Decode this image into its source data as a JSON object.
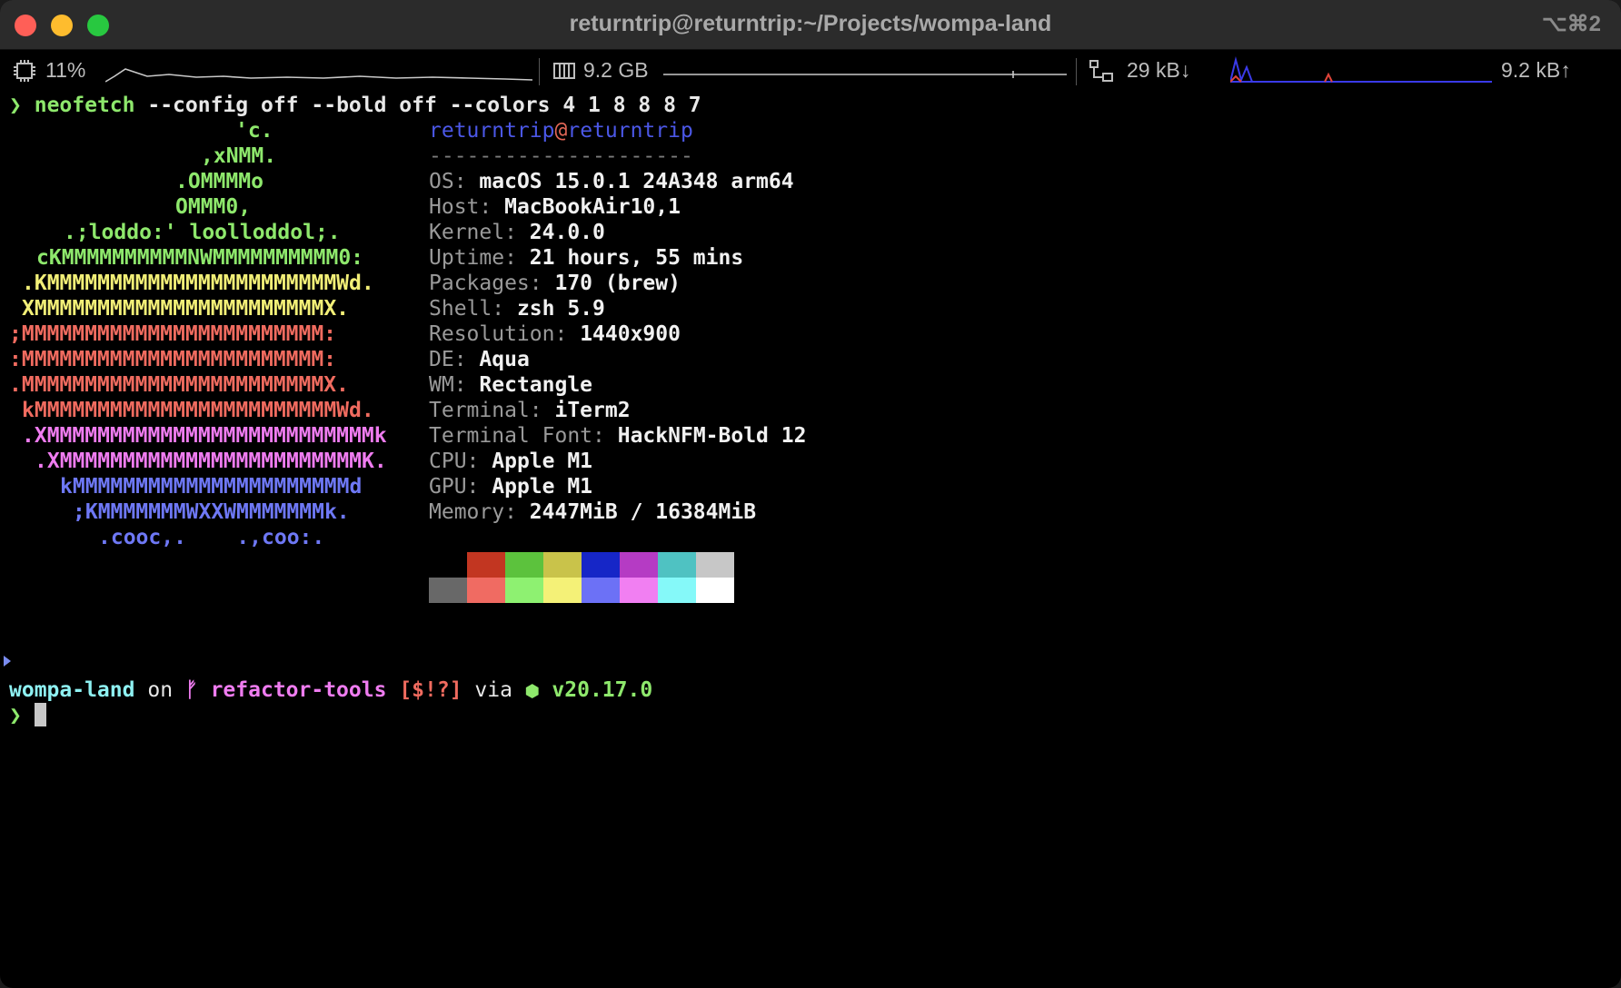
{
  "window": {
    "title": "returntrip@returntrip:~/Projects/wompa-land",
    "shortcut": "⌥⌘2"
  },
  "status": {
    "cpu": "11%",
    "memory": "9.2 GB",
    "net_down": "29 kB↓",
    "net_up": "9.2 kB↑",
    "icons": [
      "cpu-chip-icon",
      "memory-icon",
      "network-icon"
    ]
  },
  "command": {
    "prompt": "❯",
    "name": "neofetch",
    "args": "--config off --bold off --colors 4 1 8 8 8 7"
  },
  "logo": {
    "lines": [
      {
        "text": "'c.",
        "color": "#8ee86c"
      },
      {
        "text": ",xNMM.",
        "color": "#8ee86c"
      },
      {
        "text": ".OMMMMo",
        "color": "#8ee86c"
      },
      {
        "text": "OMMM0,",
        "color": "#8ee86c"
      },
      {
        "text": ".;loddo:' loolloddol;.",
        "color": "#8ee86c"
      },
      {
        "text": "cKMMMMMMMMMMNWMMMMMMMMMM0:",
        "color": "#8ee86c"
      },
      {
        "text": ".KMMMMMMMMMMMMMMMMMMMMMMMWd.",
        "color": "#f2ef77"
      },
      {
        "text": "XMMMMMMMMMMMMMMMMMMMMMMMX.",
        "color": "#f2ef77"
      },
      {
        "text": ";MMMMMMMMMMMMMMMMMMMMMMMM:",
        "color": "#f06b5f"
      },
      {
        "text": ":MMMMMMMMMMMMMMMMMMMMMMMM:",
        "color": "#f06b5f"
      },
      {
        "text": ".MMMMMMMMMMMMMMMMMMMMMMMMX.",
        "color": "#f06b5f"
      },
      {
        "text": "kMMMMMMMMMMMMMMMMMMMMMMMMWd.",
        "color": "#f06b5f"
      },
      {
        "text": ".XMMMMMMMMMMMMMMMMMMMMMMMMMMk",
        "color": "#ef7cf0"
      },
      {
        "text": ".XMMMMMMMMMMMMMMMMMMMMMMMMK.",
        "color": "#ef7cf0"
      },
      {
        "text": "kMMMMMMMMMMMMMMMMMMMMMMd",
        "color": "#6e78f5"
      },
      {
        "text": ";KMMMMMMMWXXWMMMMMMMk.",
        "color": "#6e78f5"
      },
      {
        "text": ".cooc,.    .,coo:.",
        "color": "#6e78f5"
      }
    ]
  },
  "info": {
    "user": "returntrip",
    "at": "@",
    "host": "returntrip",
    "dashes": "---------------------",
    "rows": [
      {
        "label": "OS:",
        "value": "macOS 15.0.1 24A348 arm64"
      },
      {
        "label": "Host:",
        "value": "MacBookAir10,1"
      },
      {
        "label": "Kernel:",
        "value": "24.0.0"
      },
      {
        "label": "Uptime:",
        "value": "21 hours, 55 mins"
      },
      {
        "label": "Packages:",
        "value": "170 (brew)"
      },
      {
        "label": "Shell:",
        "value": "zsh 5.9"
      },
      {
        "label": "Resolution:",
        "value": "1440x900"
      },
      {
        "label": "DE:",
        "value": "Aqua"
      },
      {
        "label": "WM:",
        "value": "Rectangle"
      },
      {
        "label": "Terminal:",
        "value": "iTerm2"
      },
      {
        "label": "Terminal Font:",
        "value": "HackNFM-Bold 12"
      },
      {
        "label": "CPU:",
        "value": "Apple M1"
      },
      {
        "label": "GPU:",
        "value": "Apple M1"
      },
      {
        "label": "Memory:",
        "value": "2447MiB / 16384MiB"
      }
    ]
  },
  "palette": {
    "row1": [
      "#000000",
      "#c23621",
      "#5cc23d",
      "#c9c34a",
      "#1626c7",
      "#b53bc4",
      "#4fc2c2",
      "#c7c7c7"
    ],
    "row2": [
      "#686868",
      "#f06b62",
      "#8ef171",
      "#f4f177",
      "#6c71f6",
      "#f17ff2",
      "#85f9f9",
      "#ffffff"
    ]
  },
  "prompt": {
    "dir": "wompa-land",
    "on": "on",
    "branch_icon": "git-branch-icon",
    "branch": "refactor-tools",
    "status": "[$!?]",
    "via": "via",
    "node_icon": "nodejs-icon",
    "node_version": "v20.17.0",
    "symbol": "❯"
  }
}
